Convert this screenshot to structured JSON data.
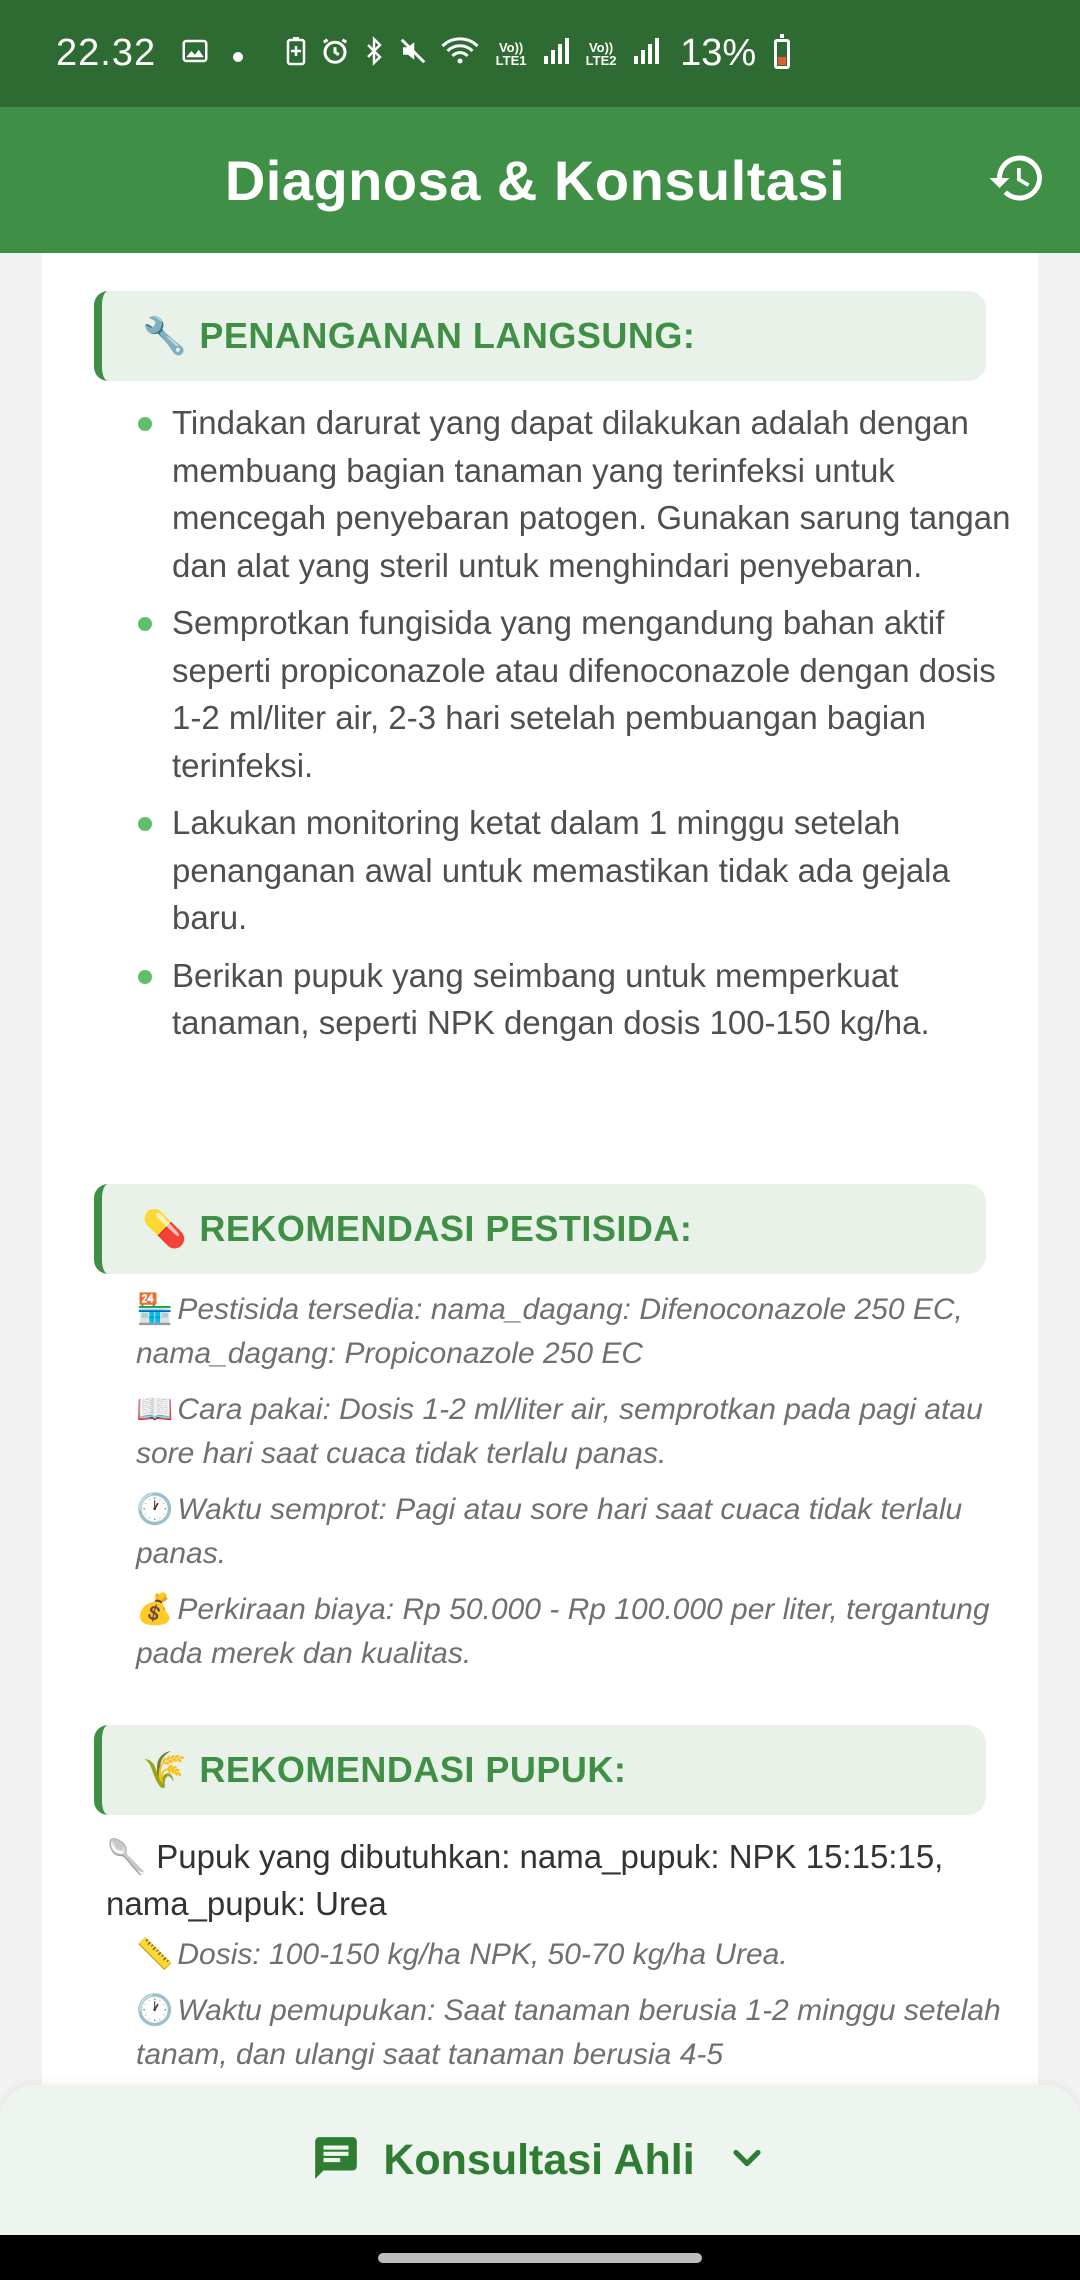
{
  "status_bar": {
    "time": "22.32",
    "lte1": "Vo)) LTE1",
    "lte2": "Vo)) LTE2",
    "battery": "13%"
  },
  "app_bar": {
    "title": "Diagnosa & Konsultasi",
    "history_icon": "history-icon"
  },
  "sections": {
    "penanganan": {
      "emoji": "🔧",
      "title": "PENANGANAN LANGSUNG:",
      "items": [
        "Tindakan darurat yang dapat dilakukan adalah dengan membuang bagian tanaman yang terinfeksi untuk mencegah penyebaran patogen. Gunakan sarung tangan dan alat yang steril untuk menghindari penyebaran.",
        "Semprotkan fungisida yang mengandung bahan aktif seperti propiconazole atau difenoconazole dengan dosis 1-2 ml/liter air, 2-3 hari setelah pembuangan bagian terinfeksi.",
        "Lakukan monitoring ketat dalam 1 minggu setelah penanganan awal untuk memastikan tidak ada gejala baru.",
        "Berikan pupuk yang seimbang untuk memperkuat tanaman, seperti NPK dengan dosis 100-150 kg/ha."
      ]
    },
    "pestisida": {
      "emoji": "💊",
      "title": "REKOMENDASI PESTISIDA:",
      "items": [
        {
          "emoji": "🏪",
          "text": "Pestisida tersedia: nama_dagang: Difenoconazole 250 EC, nama_dagang: Propiconazole 250 EC"
        },
        {
          "emoji": "📖",
          "text": "Cara pakai: Dosis 1-2 ml/liter air, semprotkan pada pagi atau sore hari saat cuaca tidak terlalu panas."
        },
        {
          "emoji": "🕐",
          "text": "Waktu semprot: Pagi atau sore hari saat cuaca tidak terlalu panas."
        },
        {
          "emoji": "💰",
          "text": "Perkiraan biaya: Rp 50.000 - Rp 100.000 per liter, tergantung pada merek dan kualitas."
        }
      ]
    },
    "pupuk": {
      "emoji": "🌾",
      "title": "REKOMENDASI PUPUK:",
      "main_line": {
        "emoji": "🥄",
        "text": "Pupuk yang dibutuhkan: nama_pupuk: NPK 15:15:15, nama_pupuk: Urea"
      },
      "items": [
        {
          "emoji": "📏",
          "text": "Dosis: 100-150 kg/ha NPK, 50-70 kg/ha Urea."
        },
        {
          "emoji": "🕐",
          "text": "Waktu pemupukan: Saat tanaman berusia 1-2 minggu setelah tanam, dan ulangi saat tanaman berusia 4-5"
        }
      ]
    }
  },
  "bottom_sheet": {
    "label": "Konsultasi Ahli",
    "icon": "chat-icon",
    "expand_icon": "chevron-down-icon"
  },
  "colors": {
    "status_bar": "#2e6b32",
    "app_bar": "#3f8f46",
    "accent": "#3f8f46",
    "header_bg": "#e9f2e8",
    "bullet": "#5fbf6a"
  }
}
